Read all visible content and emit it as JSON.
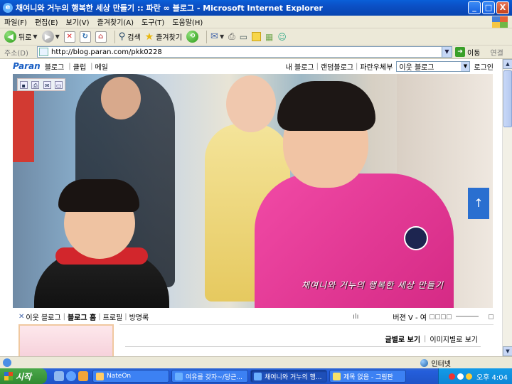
{
  "window": {
    "title": "채여니와 거누의 행복한 세상 만들기 :: 파란 ∞ 블로그 - Microsoft Internet Explorer",
    "min": "_",
    "max": "□",
    "close": "X"
  },
  "menubar": [
    "파일(F)",
    "편집(E)",
    "보기(V)",
    "즐겨찾기(A)",
    "도구(T)",
    "도움말(H)"
  ],
  "toolbar": {
    "back_label": "뒤로",
    "search_label": "검색",
    "favorites_label": "즐겨찾기"
  },
  "address": {
    "label": "주소(D)",
    "url": "http://blog.paran.com/pkk0228",
    "go_label": "이동",
    "links_label": "연결"
  },
  "paran_bar": {
    "logo": "Paran",
    "left_links": [
      "블로그",
      "클럽",
      "메일"
    ],
    "right_links": [
      "내 블로그",
      "랜덤블로그",
      "파란우체부"
    ],
    "select_value": "이웃 블로그",
    "login_label": "로그인"
  },
  "hero": {
    "caption": "채여니와 거누의 행복한 세상 만들기"
  },
  "subnav": {
    "neighbor_blog": "이웃 블로그",
    "links": [
      "블로그 홈",
      "프로필",
      "방명록"
    ],
    "version_label": "버젼 V - 여"
  },
  "view_links": {
    "text_view": "글별로 보기",
    "image_view": "이미지별로 보기"
  },
  "statusbar": {
    "left": "",
    "zone": "인터넷"
  },
  "taskbar": {
    "start": "시작",
    "tasks": [
      "NateOn",
      "여유를 갖자~/당근...",
      "채여니와 거누의 행...",
      "제목 없음 - 그림판"
    ],
    "clock": "오후 4:04"
  }
}
